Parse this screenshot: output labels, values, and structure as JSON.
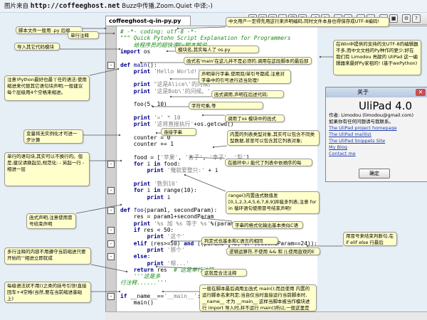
{
  "banner": {
    "prefix": "图片来自",
    "url": "http://coffeeghost.net",
    "suffix": "Buzz中传播,Zoom.Quiet 中译;-)"
  },
  "editor": {
    "tab_label": "coffeeghost-q-in-py.py",
    "lines": [
      {
        "n": "",
        "html": "<span class='cm'># -*- coding: utf-8 -*-</span>"
      },
      {
        "n": "",
        "html": "<span class='cm'>\"\"\" Quick Pytohn Script Explanation for Programmers</span>"
      },
      {
        "n": "",
        "html": "<span class='cm'>    给程序员的超快速Py脚本解说</span>"
      },
      {
        "n": "",
        "html": "<span class='kw'>import</span> os"
      },
      {
        "n": "",
        "html": ""
      },
      {
        "n": "-",
        "html": "<span class='kw'>def</span> <span class='fn'>main</span>():"
      },
      {
        "n": "",
        "html": "    <span class='kw'>print</span> <span class='st'>'Hello World!'</span>"
      },
      {
        "n": "",
        "html": ""
      },
      {
        "n": "",
        "html": "    <span class='kw'>print</span> <span class='st'>\"这是Alice\\'的问候。\"</span>"
      },
      {
        "n": "",
        "html": "    <span class='kw'>print</span> <span class='st'>'这是Bob\\'的问候。'</span>"
      },
      {
        "n": "",
        "html": ""
      },
      {
        "n": "",
        "html": "    foo(5, 10)"
      },
      {
        "n": "",
        "html": ""
      },
      {
        "n": "",
        "html": "    <span class='kw'>print</span> <span class='st'>'=' * 10</span>"
      },
      {
        "n": "",
        "html": "    <span class='kw'>print</span> <span class='st'>'这将直接执行'</span>+os.getcwd()"
      },
      {
        "n": "",
        "html": ""
      },
      {
        "n": "",
        "html": "    counter = 0"
      },
      {
        "n": "",
        "html": "    counter += 1"
      },
      {
        "n": "",
        "html": ""
      },
      {
        "n": "",
        "html": "    food = [<span class='st'>'苹果'</span>, <span class='st'>'杏子'</span>, <span class='st'>'李子'</span>, <span class='st'>'梨'</span>]"
      },
      {
        "n": "-",
        "html": "    <span class='kw'>for</span> i <span class='kw'>in</span> food:"
      },
      {
        "n": "",
        "html": "        <span class='kw'>print</span> <span class='st'>'俺就爱整只:'</span> + i"
      },
      {
        "n": "",
        "html": ""
      },
      {
        "n": "",
        "html": "    <span class='kw'>print</span> <span class='st'>'数到10'</span>"
      },
      {
        "n": "-",
        "html": "    <span class='kw'>for</span> i <span class='kw'>in</span> range(10):"
      },
      {
        "n": "",
        "html": "        <span class='kw'>print</span> i"
      },
      {
        "n": "",
        "html": ""
      },
      {
        "n": "-",
        "html": "<span class='kw'>def</span> <span class='fn'>foo</span>(param1, secondParam):"
      },
      {
        "n": "",
        "html": "    res = param1+secondParam"
      },
      {
        "n": "",
        "html": "    <span class='kw'>print</span> <span class='st'>'%s 加 %s 等于 %s'</span>%(param1, secondParam, res)"
      },
      {
        "n": "-",
        "html": "    <span class='kw'>if</span> res &lt; 50:"
      },
      {
        "n": "",
        "html": "        <span class='kw'>print</span> <span class='st'>'这个'</span>"
      },
      {
        "n": "-",
        "html": "    <span class='kw'>elif</span> (res&gt;=50) <span class='kw'>and</span> ((param1==42) <span class='kw'>or</span> (secondParam==24)):"
      },
      {
        "n": "",
        "html": "        <span class='kw'>print</span> <span class='st'>'那个'</span>"
      },
      {
        "n": "-",
        "html": "    <span class='kw'>else</span>:"
      },
      {
        "n": "",
        "html": "        <span class='kw'>print</span> <span class='st'>'嗯...'</span>"
      },
      {
        "n": "",
        "html": "    <span class='kw'>return</span> res  <span class='cm'># 这是单行注释</span>"
      },
      {
        "n": "",
        "html": "    <span class='cm'>'''这是多</span>"
      },
      {
        "n": "",
        "html": "<span class='cm'>行注释......'''</span>"
      },
      {
        "n": "",
        "html": ""
      },
      {
        "n": "-",
        "html": "<span class='kw'>if</span> __name__==<span class='st'>'__main__'</span>:"
      },
      {
        "n": "",
        "html": "    main()"
      }
    ]
  },
  "callouts": [
    {
      "text": "脚本文件一般用 .py 后缀"
    },
    {
      "text": "单行注释"
    },
    {
      "text": "导入其它代码模块"
    },
    {
      "text": "注意!Python最好也最丫任的语法:使用缩进来代替其它语句块声明;一般建议每个层级用4个空格来缩进。"
    },
    {
      "text": "变量将无实例化才可进一步计算"
    },
    {
      "text": "单行的语句块,其实可以不换行的。但是,建议请换起见,规范化: - 另起一行 - 相进一层"
    },
    {
      "text": "函式声明,注意使用冒号结束声明"
    },
    {
      "text": "多行注释的内容不用遵守当前缩进只要开始的'''相进立即就成"
    },
    {
      "text": "每级语法状不用()之类的括号引领!直接回车+4空格(当然,要在当前缩进基础上)"
    },
    {
      "text": "中文用户一定得先用这行来声明编码,同时文件本身也得保存成UTF-8编码!"
    },
    {
      "text": "模块名,其实每人了 os.py"
    },
    {
      "text": "函式名'main'在这儿并不是必须的,调用在这段脚本的最后部分;"
    },
    {
      "text": "声明单行字串,使用双/单引号都成,注意对字串中的引号进行适当处理!"
    },
    {
      "text": "函式调用,声明在后述代码;"
    },
    {
      "text": "字符可乘,等于'=========='"
    },
    {
      "text": "调用了os 模块中的函式"
    },
    {
      "text": "连接字串"
    },
    {
      "text": "内置的列表类型对象,其实可以包含不同类型数据,甚至可以包含其它列表对象;"
    },
    {
      "text": "在循环中,i 能代了列表中依顺序的每个\"food\""
    },
    {
      "text": "range()内置函式数值发[0,1,2,3,4,5,6,7,8,9]并能多列表,注意 for in 循环语句使用冒号结束声明!"
    },
    {
      "text": "字串的格式化输出基本类似C语言的"
    },
    {
      "text": "判定式也基本和C语言的相同"
    },
    {
      "text": "逻辑运算符,不使用 && 和 ||,使用直观的E文单词"
    },
    {
      "text": "这就是合法注释"
    },
    {
      "text": "用冒号来结束判断句,在 if elif else 行最后"
    },
    {
      "text": "一般在脚本最后调用主函式 main();而且使用 内置的运行脚本名来判定;当自仅当时直接运行当前脚本时, __name__ 才为 __main__ 这样当脚本被当作模块进行 import 导入时,并不运行 main()所以,一般这里是进行测试代码设置的。"
    },
    {
      "text": "在Win中提供的支持的文UTF-8的编辑器不多,而中文文档的Py种作的更少;好在我们有 Limodou 亮献的 UliPad 这一编辑器来最好Py家祖的! (基于wxPython)"
    }
  ],
  "about": {
    "title": "关于",
    "app_name": "UliPad 4.0",
    "author": "作者: Limodou (limodou@gmail.com)",
    "note": "如果你有任何问题请与我联系。",
    "links": [
      "The UliPad project homepage",
      "The UliPad maillist",
      "The UliPad Snippets Site",
      "My Blog",
      "Contact me"
    ],
    "ok_label": "确定"
  }
}
